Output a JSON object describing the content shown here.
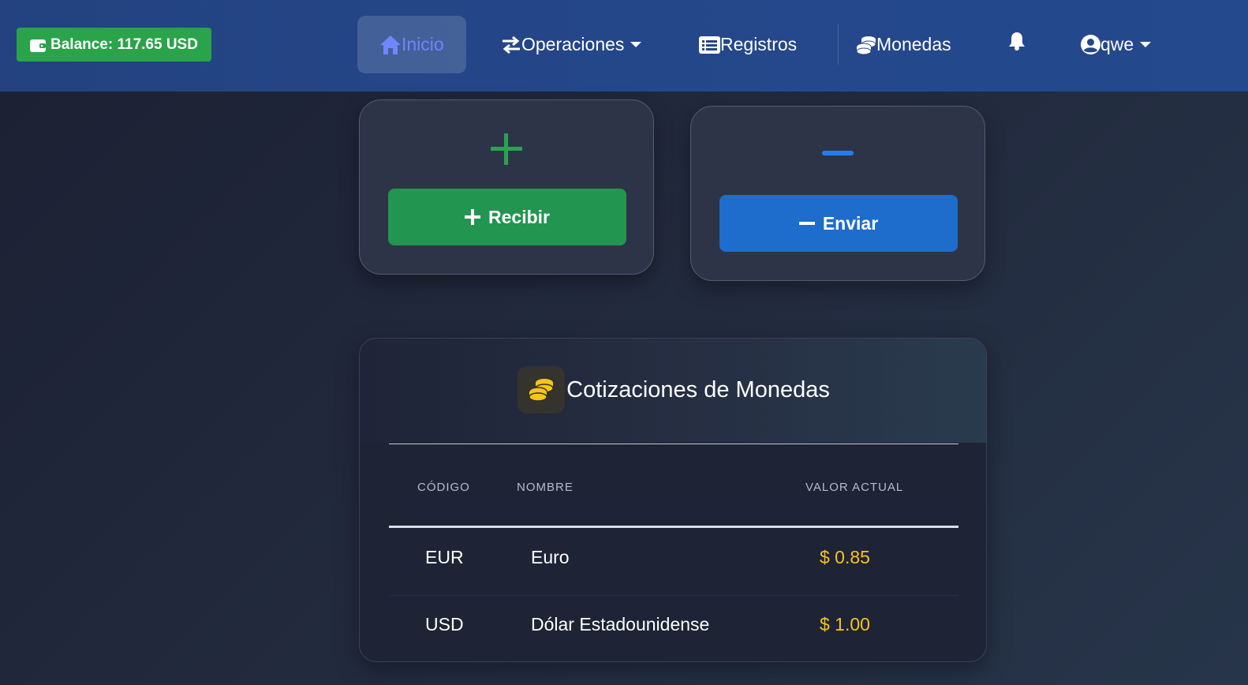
{
  "navbar": {
    "balance": "Balance: 117.65 USD",
    "items": [
      {
        "label": "Inicio",
        "icon": "home-icon"
      },
      {
        "label": "Operaciones",
        "icon": "exchange-icon"
      },
      {
        "label": "Registros",
        "icon": "list-icon"
      },
      {
        "label": "Monedas",
        "icon": "coins-icon"
      }
    ],
    "user": "qwe"
  },
  "actions": {
    "recibir": "Recibir",
    "enviar": "Enviar"
  },
  "quotes": {
    "title": "Cotizaciones de Monedas",
    "headers": [
      "CÓDIGO",
      "NOMBRE",
      "VALOR ACTUAL"
    ],
    "rows": [
      {
        "code": "EUR",
        "name": "Euro",
        "value": "$ 0.85"
      },
      {
        "code": "USD",
        "name": "Dólar Estadounidense",
        "value": "$ 1.00"
      }
    ]
  },
  "colors": {
    "navbar": "#24478a",
    "balance_green": "#2aa34a",
    "recibir_green": "#229551",
    "enviar_blue": "#1e6ccc",
    "value_gold": "#f6c51a",
    "active_link": "#6f86ff"
  }
}
